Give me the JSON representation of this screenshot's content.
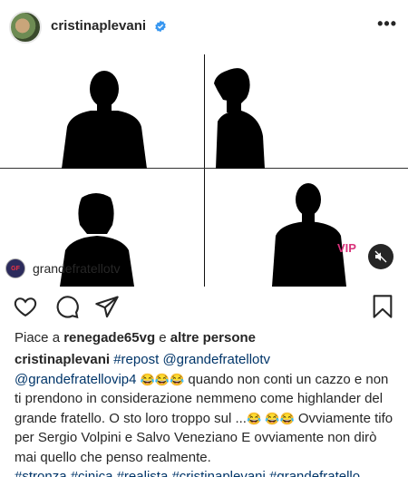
{
  "header": {
    "username": "cristinaplevani",
    "more_icon": "more-icon",
    "verified_icon": "verified-badge-icon",
    "verified_color": "#3897f0"
  },
  "media": {
    "tag_username": "grandefratellotv",
    "tag_avatar_text": "GF",
    "logo_text": "VIP",
    "mute_icon": "speaker-muted-icon"
  },
  "actions": {
    "like_icon": "heart-icon",
    "comment_icon": "comment-icon",
    "share_icon": "send-icon",
    "save_icon": "bookmark-icon"
  },
  "likes": {
    "prefix": "Piace a",
    "user": "renegade65vg",
    "connector": "e",
    "others": "altre persone"
  },
  "caption": {
    "username": "cristinaplevani",
    "repost": "#repost",
    "mention1": "@grandefratellotv",
    "mention2": "@grandefratellovip4",
    "emoji_laugh": "😂😂😂",
    "text1": "quando non conti un cazzo e non ti prendono in considerazione nemmeno come highlander del grande fratello. O sto loro troppo sul ...",
    "emoji_laugh_single": "😂",
    "emoji_laugh_double": "😂😂",
    "text2": "Ovviamente tifo per Sergio Volpini e Salvo Veneziano",
    "text3": "E ovviamente non dirò mai quello che penso realmente.",
    "hashtags": [
      "#stronza",
      "#cinica",
      "#realista",
      "#cristinaplevani",
      "#grandefratello"
    ]
  },
  "colors": {
    "text": "#262626",
    "link": "#003569",
    "silhouette": "#000000"
  }
}
